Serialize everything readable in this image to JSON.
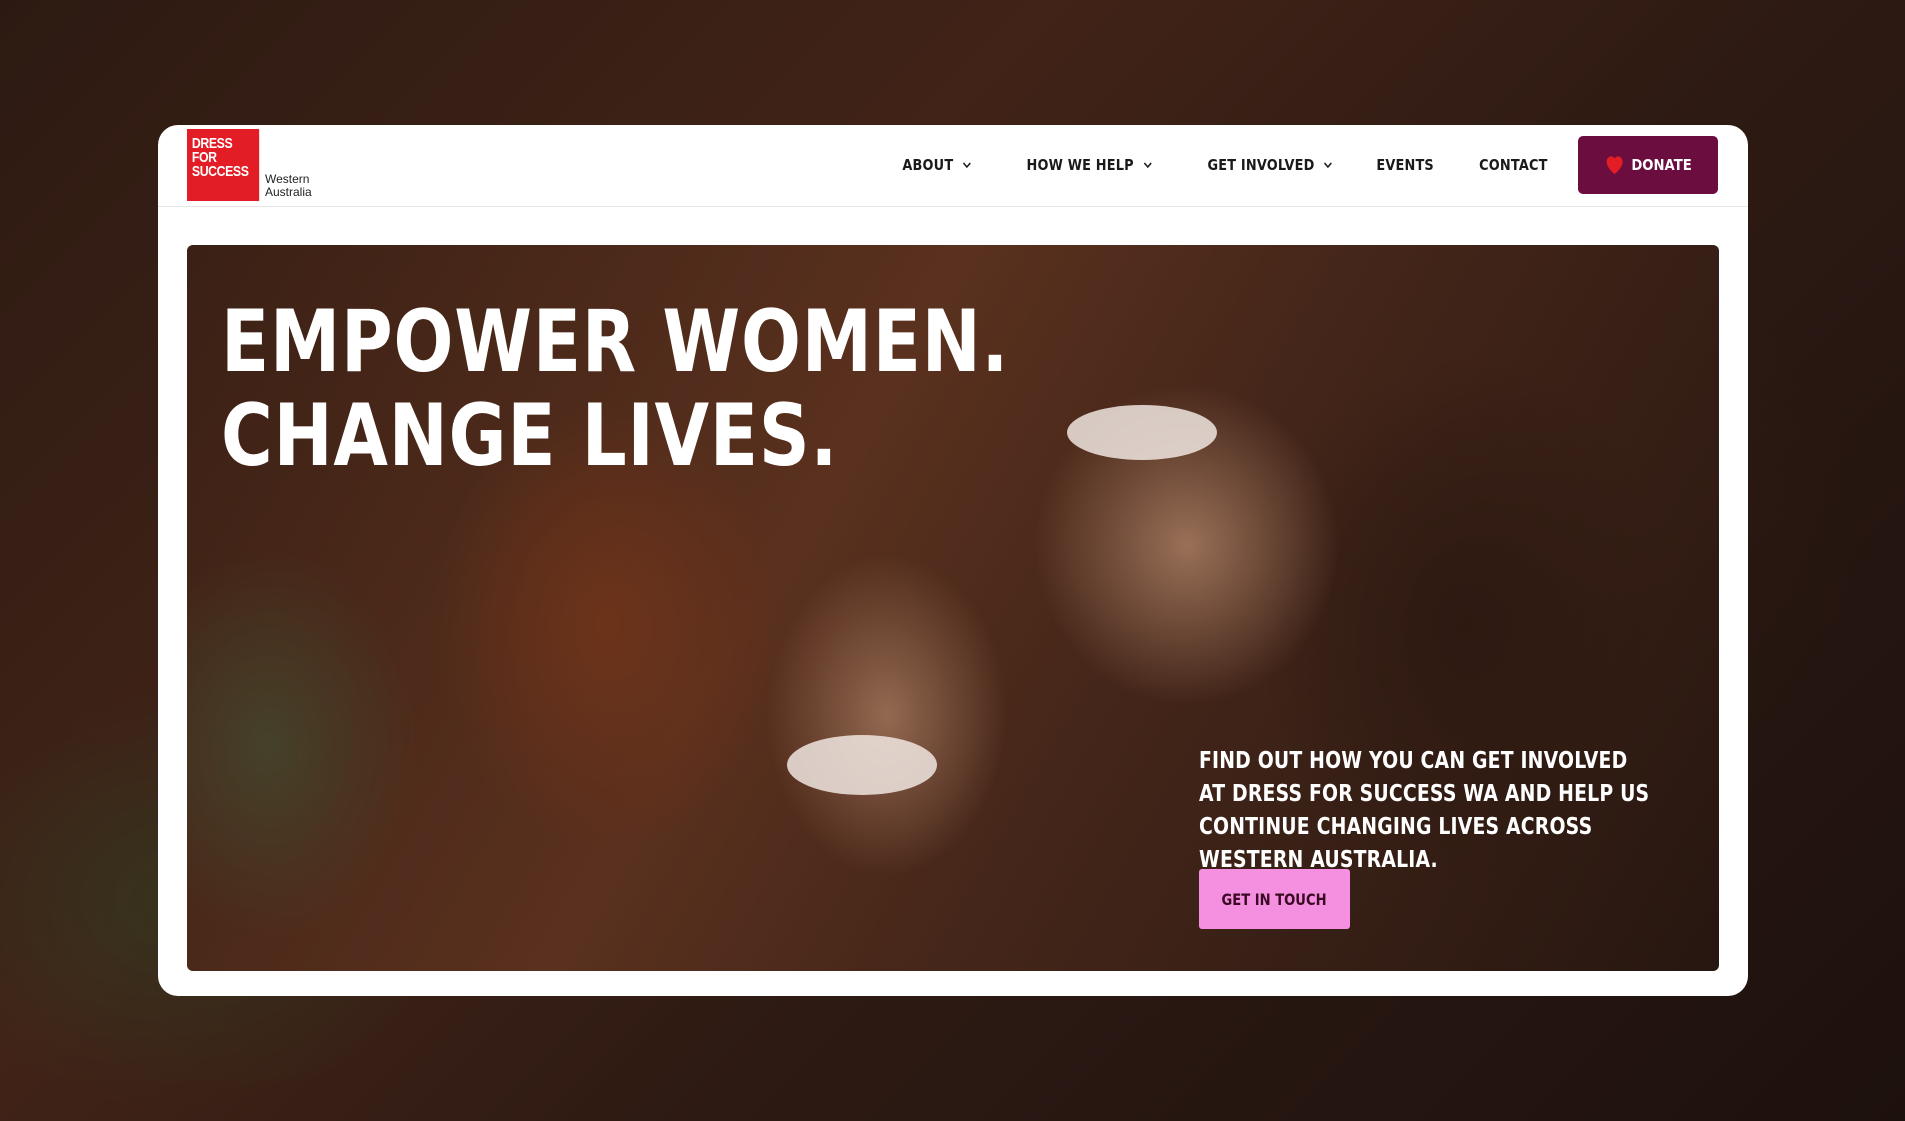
{
  "logo": {
    "lines": [
      "DRESS",
      "FOR",
      "SUCCESS"
    ],
    "region_lines": [
      "Western",
      "Australia"
    ]
  },
  "nav": {
    "items": [
      {
        "label": "ABOUT",
        "has_dropdown": true
      },
      {
        "label": "HOW WE HELP",
        "has_dropdown": true
      },
      {
        "label": "GET INVOLVED",
        "has_dropdown": true
      },
      {
        "label": "EVENTS",
        "has_dropdown": false
      },
      {
        "label": "CONTACT",
        "has_dropdown": false
      }
    ],
    "donate_label": "DONATE"
  },
  "hero": {
    "title_lines": [
      "EMPOWER WOMEN.",
      "CHANGE LIVES."
    ],
    "body": "FIND OUT HOW YOU CAN GET INVOLVED AT DRESS FOR SUCCESS WA AND HELP US CONTINUE CHANGING LIVES ACROSS WESTERN AUSTRALIA.",
    "cta_label": "GET IN TOUCH"
  },
  "colors": {
    "logo_red": "#e21d25",
    "donate_bg": "#6b0d3f",
    "cta_bg": "#f58fe0"
  }
}
